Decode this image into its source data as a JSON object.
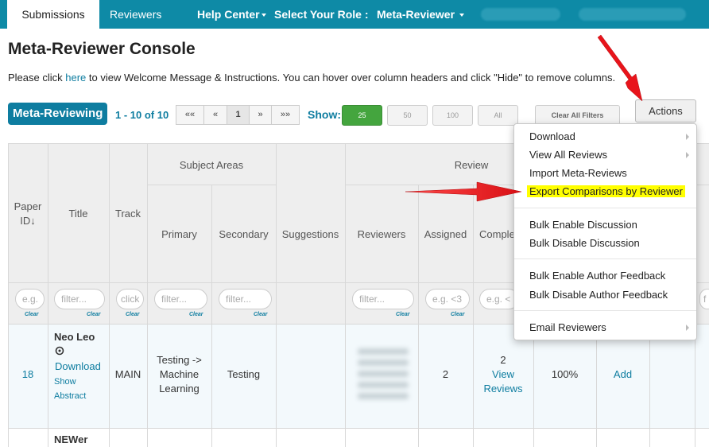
{
  "nav": {
    "submissions": "Submissions",
    "reviewers": "Reviewers",
    "help_center": "Help Center",
    "select_role": "Select Your Role :",
    "role": "Meta-Reviewer"
  },
  "page": {
    "title": "Meta-Reviewer Console",
    "intro_before": "Please click ",
    "intro_link": "here",
    "intro_after": " to view Welcome Message & Instructions. You can hover over column headers and click \"Hide\" to remove columns."
  },
  "toolbar": {
    "badge": "Meta-Reviewing",
    "range": "1 - 10 of 10",
    "pager": [
      "««",
      "«",
      "1",
      "»",
      "»»"
    ],
    "show_label": "Show:",
    "sizes": [
      "25",
      "50",
      "100",
      "All"
    ],
    "clear_filters": "Clear All Filters",
    "actions": "Actions"
  },
  "table": {
    "headers": {
      "paper_id_1": "Paper",
      "paper_id_2": "ID",
      "title": "Title",
      "track": "Track",
      "subject_areas": "Subject Areas",
      "primary": "Primary",
      "secondary": "Secondary",
      "suggestions": "Suggestions",
      "review": "Review",
      "reviewers": "Reviewers",
      "assigned": "Assigned",
      "completed": "Comple"
    },
    "filters": {
      "paper_id": "e.g.",
      "title": "filter...",
      "track": "click",
      "primary": "filter...",
      "secondary": "filter...",
      "reviewers": "filter...",
      "assigned": "e.g. <3",
      "completed": "e.g. <",
      "last": "f"
    },
    "clear_label": "Clear",
    "rows": [
      {
        "id": "18",
        "title": "Neo Leo",
        "download": "Download",
        "show_abstract_1": "Show",
        "show_abstract_2": "Abstract",
        "track": "MAIN",
        "primary_1": "Testing ->",
        "primary_2": "Machine",
        "primary_3": "Learning",
        "secondary": "Testing",
        "assigned": "2",
        "completed": "2",
        "view_reviews_1": "View",
        "view_reviews_2": "Reviews",
        "percent": "100%",
        "add": "Add"
      },
      {
        "title": "NEWer"
      }
    ]
  },
  "actions_menu": {
    "items": [
      "Download",
      "View All Reviews",
      "Import Meta-Reviews",
      "Export Comparisons by Reviewer",
      "Bulk Enable Discussion",
      "Bulk Disable Discussion",
      "Bulk Enable Author Feedback",
      "Bulk Disable Author Feedback",
      "Email Reviewers"
    ]
  },
  "colors": {
    "nav_bg": "#0e8aa6",
    "accent": "#0e7da0",
    "highlight": "#ffff00",
    "arrow": "#e8141b",
    "green": "#44a53e"
  }
}
